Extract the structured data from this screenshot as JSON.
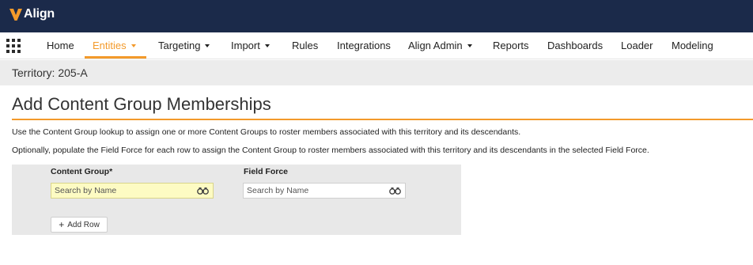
{
  "app": {
    "name": "Align",
    "logo_icon": "veeva-v-icon"
  },
  "nav": {
    "apps_icon": "grid-apps-icon",
    "items": [
      {
        "label": "Home",
        "dropdown": false,
        "active": false
      },
      {
        "label": "Entities",
        "dropdown": true,
        "active": true
      },
      {
        "label": "Targeting",
        "dropdown": true,
        "active": false
      },
      {
        "label": "Import",
        "dropdown": true,
        "active": false
      },
      {
        "label": "Rules",
        "dropdown": false,
        "active": false
      },
      {
        "label": "Integrations",
        "dropdown": false,
        "active": false
      },
      {
        "label": "Align Admin",
        "dropdown": true,
        "active": false
      },
      {
        "label": "Reports",
        "dropdown": false,
        "active": false
      },
      {
        "label": "Dashboards",
        "dropdown": false,
        "active": false
      },
      {
        "label": "Loader",
        "dropdown": false,
        "active": false
      },
      {
        "label": "Modeling",
        "dropdown": false,
        "active": false
      }
    ]
  },
  "territory": {
    "label": "Territory: 205-A"
  },
  "page": {
    "title": "Add Content Group Memberships",
    "description_1": "Use the Content Group lookup to assign one or more Content Groups to roster members associated with this territory and its descendants.",
    "description_2": "Optionally, populate the Field Force for each row to assign the Content Group to roster members associated with this territory and its descendants in the selected Field Force."
  },
  "form": {
    "content_group_label": "Content Group*",
    "field_force_label": "Field Force",
    "content_group_placeholder": "Search by Name",
    "field_force_placeholder": "Search by Name",
    "content_group_value": "",
    "field_force_value": "",
    "lookup_icon": "binoculars-icon",
    "add_row_label": "Add Row",
    "add_row_icon": "plus-icon"
  },
  "colors": {
    "header_bg": "#1b2a4a",
    "accent": "#f39a2b",
    "required_field_bg": "#fdfbc3",
    "panel_bg": "#e8e8e8"
  }
}
